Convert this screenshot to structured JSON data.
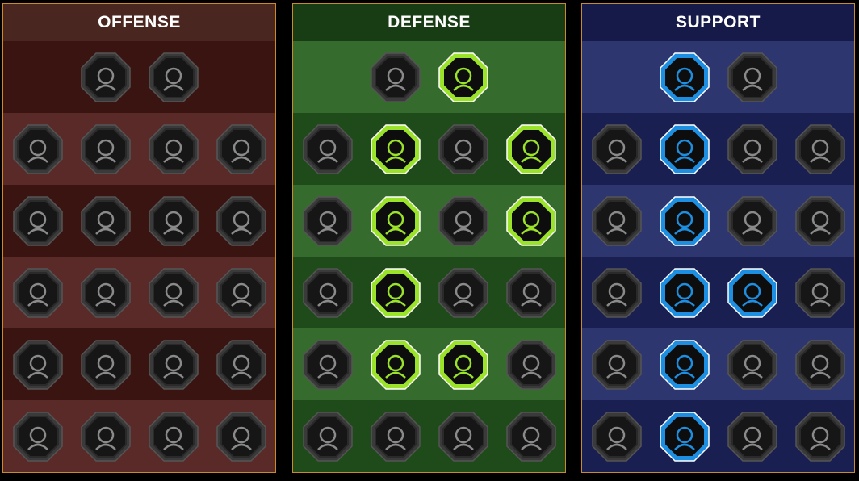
{
  "trees": [
    {
      "id": "offense",
      "title": "OFFENSE",
      "tiers": [
        [
          "crossed-swords-icon",
          "triple-slash-icon"
        ],
        [
          "horned-warrior-icon",
          "piercing-sword-icon",
          "shield-breaker-icon",
          "heart-burst-icon"
        ],
        [
          "armored-archer-icon",
          "fanged-maw-icon",
          "skull-streak-icon",
          "clenched-fist-icon"
        ],
        [
          "bleeding-sword-icon",
          "hammer-fist-icon",
          "axe-strike-icon",
          "chain-lightning-icon"
        ],
        [
          "blade-strike-icon",
          "skull-bubbles-icon",
          "dagger-circle-icon",
          "lightning-warrior-icon"
        ],
        [
          "sword-sparkle-icon",
          "knight-helmet-icon",
          "horned-demon-icon",
          "spartan-skull-icon"
        ]
      ],
      "active": [],
      "colors": {
        "header": "#4a2620",
        "active_fill": "#c0392b"
      }
    },
    {
      "id": "defense",
      "title": "DEFENSE",
      "tiers": [
        [
          "brick-wall-icon",
          "raised-fist-icon"
        ],
        [
          "layered-shield-icon",
          "heart-shield-icon",
          "muscle-torso-icon",
          "broken-blades-icon"
        ],
        [
          "shadow-warrior-icon",
          "knight-shield-icon",
          "skull-heart-icon",
          "aura-head-icon"
        ],
        [
          "crowd-icon",
          "hourglass-icon",
          "open-hand-icon",
          "bull-skull-icon"
        ],
        [
          "dash-runner-icon",
          "triple-claw-icon",
          "sun-skull-icon",
          "circular-arrow-icon"
        ],
        [
          "spiky-knight-icon",
          "winged-shield-icon",
          "bearded-warrior-icon",
          "strongman-icon"
        ]
      ],
      "active": [
        [
          0,
          1
        ],
        [
          1,
          1
        ],
        [
          1,
          3
        ],
        [
          2,
          1
        ],
        [
          2,
          3
        ],
        [
          3,
          1
        ],
        [
          4,
          1
        ],
        [
          4,
          2
        ]
      ],
      "colors": {
        "header": "#183d14",
        "active_fill": "#9be22a"
      }
    },
    {
      "id": "support",
      "title": "SUPPORT",
      "tiers": [
        [
          "heart-plus-icon",
          "spiral-wave-icon"
        ],
        [
          "praying-hands-icon",
          "energy-shield-icon",
          "flaming-skull-icon",
          "shield-charge-icon"
        ],
        [
          "healing-figure-icon",
          "lightning-shield-icon",
          "cracked-ground-icon",
          "shadow-twins-icon"
        ],
        [
          "heart-chain-icon",
          "comet-icon",
          "open-book-icon",
          "angry-eyes-icon"
        ],
        [
          "compass-star-icon",
          "winged-boot-icon",
          "all-seeing-eye-icon",
          "stick-figure-icon"
        ],
        [
          "potion-flask-icon",
          "horned-skull-icon",
          "fist-sigil-icon",
          "eagle-head-icon"
        ]
      ],
      "active": [
        [
          0,
          0
        ],
        [
          1,
          1
        ],
        [
          2,
          1
        ],
        [
          3,
          1
        ],
        [
          3,
          2
        ],
        [
          4,
          1
        ],
        [
          5,
          1
        ]
      ],
      "colors": {
        "header": "#161a48",
        "active_fill": "#1e8fe0"
      }
    }
  ]
}
